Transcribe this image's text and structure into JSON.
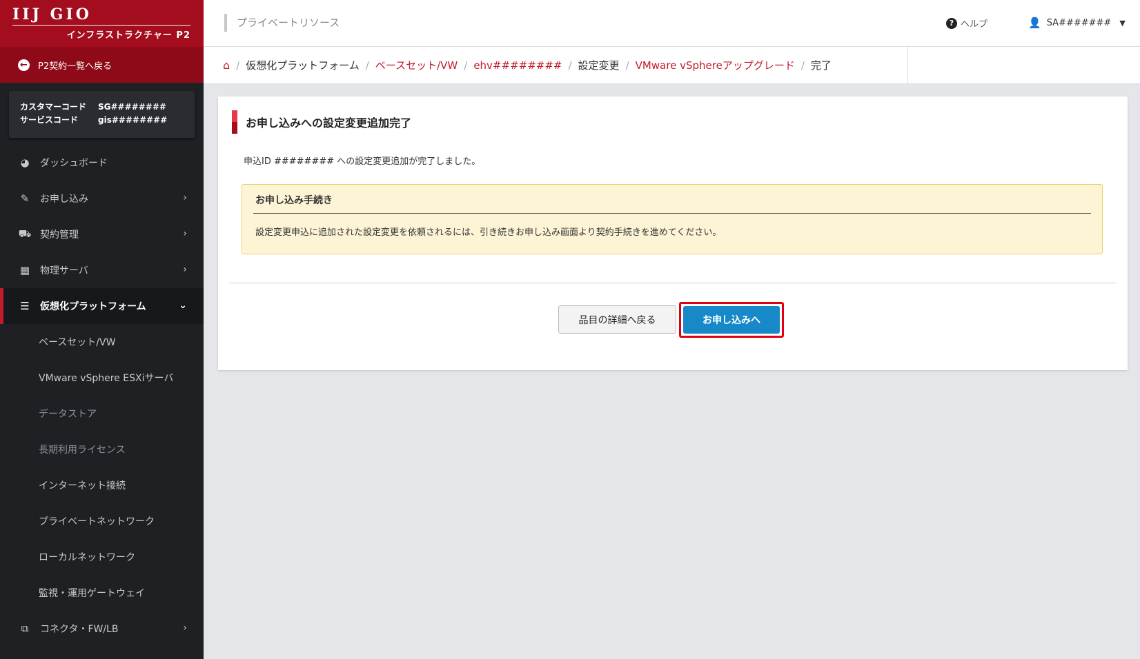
{
  "brand": {
    "logo": "IIJ GIO",
    "subtitle": "インフラストラクチャー P2"
  },
  "sidebar": {
    "back_label": "P2契約一覧へ戻る",
    "customer_code_label": "カスタマーコード",
    "customer_code": "SG########",
    "service_code_label": "サービスコード",
    "service_code": "gis########",
    "items": [
      {
        "label": "ダッシュボード",
        "icon": "dashboard-icon"
      },
      {
        "label": "お申し込み",
        "icon": "edit-icon"
      },
      {
        "label": "契約管理",
        "icon": "truck-icon"
      },
      {
        "label": "物理サーバ",
        "icon": "server-icon"
      },
      {
        "label": "仮想化プラットフォーム",
        "icon": "virtual-platform-icon"
      },
      {
        "label": "コネクタ・FW/LB",
        "icon": "share-icon"
      }
    ],
    "sub_items": [
      "ベースセット/VW",
      "VMware vSphere ESXiサーバ",
      "データストア",
      "長期利用ライセンス",
      "インターネット接続",
      "プライベートネットワーク",
      "ローカルネットワーク",
      "監視・運用ゲートウェイ"
    ]
  },
  "header": {
    "title": "プライベートリソース",
    "help_label": "ヘルプ",
    "user_label": "SA#######"
  },
  "breadcrumb": {
    "items": [
      "仮想化プラットフォーム",
      "ベースセット/VW",
      "ehv########",
      "設定変更",
      "VMware vSphereアップグレード",
      "完了"
    ]
  },
  "main": {
    "title": "お申し込みへの設定変更追加完了",
    "message": "申込ID ######## への設定変更追加が完了しました。",
    "notice_title": "お申し込み手続き",
    "notice_body": "設定変更申込に追加された設定変更を依頼されるには、引き続きお申し込み画面より契約手続きを進めてください。",
    "back_button": "品目の詳細へ戻る",
    "apply_button": "お申し込みへ"
  },
  "colors": {
    "brand_red": "#a30d1e",
    "link_red": "#c31a2c",
    "primary_blue": "#1889c8",
    "highlight_red": "#e0000f",
    "notice_bg": "#fdf4d6"
  }
}
